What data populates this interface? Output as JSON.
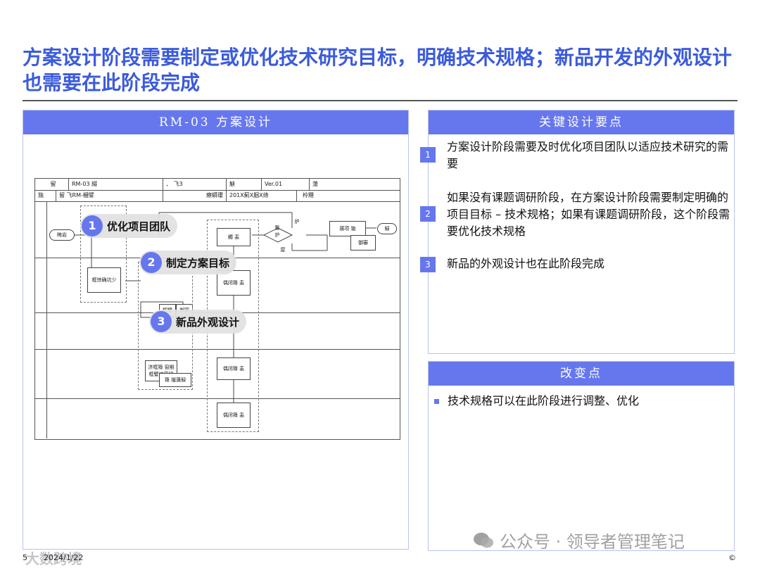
{
  "title": "方案设计阶段需要制定或优化技术研究目标，明确技术规格；新品开发的外观设计也需要在此阶段完成",
  "left_panel": {
    "header": "RM-03 方案设计",
    "flow_header": {
      "r1": [
        "留",
        "RM-03 綴",
        "、 飞3",
        "觖",
        "Ver.01",
        "蔆"
      ],
      "r2": [
        "旐",
        "留 飞RM-槶譬",
        "瘵蟒瓔",
        "201X薊X胭X绦",
        "柃黫"
      ]
    },
    "flow_boxes": {
      "start": "睥岩",
      "b1": "框惊确坑少",
      "b2": "觸 恚",
      "b3": "偶闭簶 恚",
      "b4a": "框譬",
      "b4b": "御審",
      "b5": "偶闭簶 恚",
      "b6": "济框簶 窗期 框譬培蓮觮",
      "b7": "簶 摧蓮觮",
      "b8": "偶闭簶 恚",
      "diamond": "鬐炉",
      "d_top": "炉",
      "d_bottom": "屋",
      "doc1": "蓀项 锄",
      "doc2": "御審",
      "end": "觮"
    },
    "badges": [
      {
        "num": "1",
        "label": "优化项目团队"
      },
      {
        "num": "2",
        "label": "制定方案目标"
      },
      {
        "num": "3",
        "label": "新品外观设计"
      }
    ]
  },
  "key_points": {
    "header": "关键设计要点",
    "items": [
      {
        "num": "1",
        "text": "方案设计阶段需要及时优化项目团队以适应技术研究的需要"
      },
      {
        "num": "2",
        "text": "如果没有课题调研阶段，在方案设计阶段需要制定明确的项目目标 – 技术规格；如果有课题调研阶段，这个阶段需要优化技术规格"
      },
      {
        "num": "3",
        "text": "新品的外观设计也在此阶段完成"
      }
    ]
  },
  "changes": {
    "header": "改变点",
    "items": [
      "技术规格可以在此阶段进行调整、优化"
    ]
  },
  "footer": {
    "page": "5",
    "date": "2024/1/22",
    "watermark": "大数跨境",
    "copyright": "©",
    "wechat": "公众号 · 领导者管理笔记"
  },
  "colors": {
    "accent": "#6677ee",
    "title": "#3b5bdb"
  }
}
